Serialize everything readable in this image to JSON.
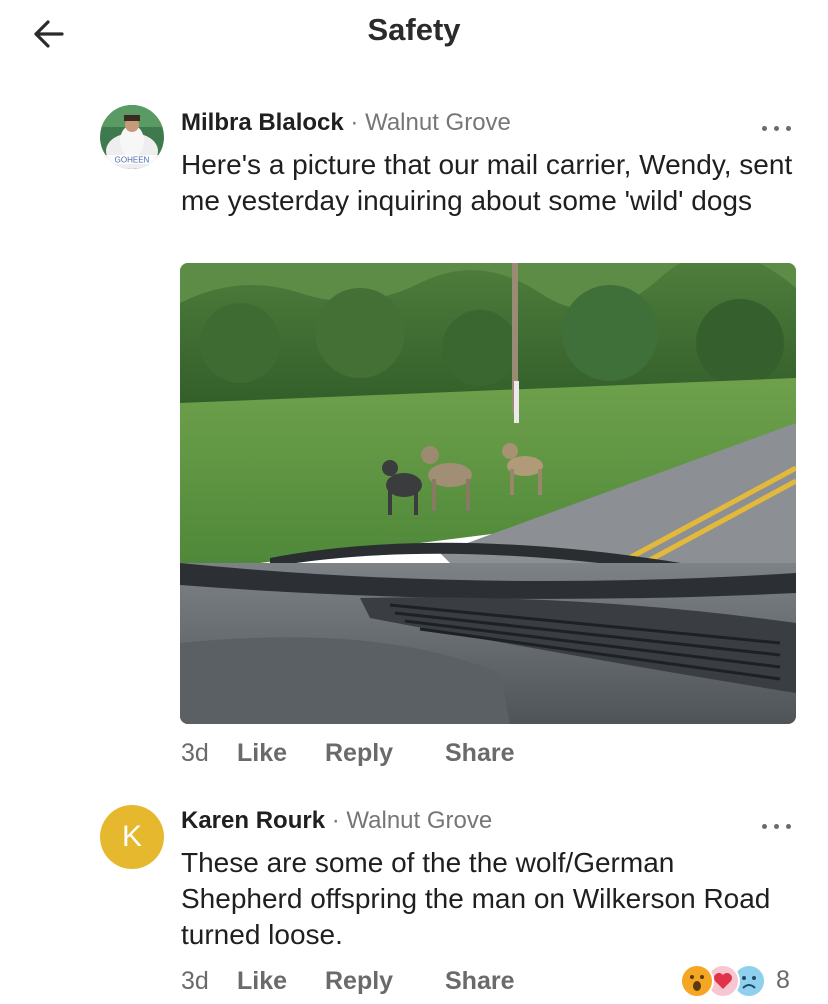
{
  "header": {
    "title": "Safety",
    "back_icon": "arrow-left-icon"
  },
  "comments": [
    {
      "author": "Milbra Blalock",
      "separator": "·",
      "location": "Walnut Grove",
      "text": "Here's a picture that our mail carrier, Wendy, sent me yesterday inquiring about some 'wild' dogs",
      "avatar_badge": "GOHEEN",
      "age": "3d",
      "like_label": "Like",
      "reply_label": "Reply",
      "share_label": "Share",
      "more_icon": "more-horizontal-icon"
    },
    {
      "author": "Karen Rourk",
      "separator": "·",
      "location": "Walnut Grove",
      "text": "These are some of the the wolf/German Shepherd offspring the man on Wilkerson Road turned loose.",
      "avatar_initial": "K",
      "avatar_color": "#e6b82e",
      "age": "3d",
      "like_label": "Like",
      "reply_label": "Reply",
      "share_label": "Share",
      "more_icon": "more-horizontal-icon",
      "reactions": {
        "icons": [
          "wow-reaction-icon",
          "heart-reaction-icon",
          "sad-reaction-icon"
        ],
        "count": "8"
      }
    }
  ]
}
